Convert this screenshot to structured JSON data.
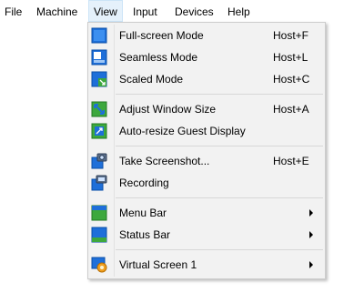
{
  "menubar": {
    "items": [
      {
        "label": "File"
      },
      {
        "label": "Machine"
      },
      {
        "label": "View"
      },
      {
        "label": "Input"
      },
      {
        "label": "Devices"
      },
      {
        "label": "Help"
      }
    ]
  },
  "view_menu": {
    "items": [
      {
        "label": "Full-screen Mode",
        "shortcut": "Host+F",
        "icon": "fullscreen-icon"
      },
      {
        "label": "Seamless Mode",
        "shortcut": "Host+L",
        "icon": "seamless-icon"
      },
      {
        "label": "Scaled Mode",
        "shortcut": "Host+C",
        "icon": "scaled-icon"
      },
      {
        "label": "Adjust Window Size",
        "shortcut": "Host+A",
        "icon": "adjust-window-icon"
      },
      {
        "label": "Auto-resize Guest Display",
        "shortcut": "",
        "icon": "auto-resize-icon"
      },
      {
        "label": "Take Screenshot...",
        "shortcut": "Host+E",
        "icon": "camera-icon"
      },
      {
        "label": "Recording",
        "shortcut": "",
        "icon": "recording-icon"
      },
      {
        "label": "Menu Bar",
        "shortcut": "",
        "icon": "menu-bar-icon",
        "submenu": true
      },
      {
        "label": "Status Bar",
        "shortcut": "",
        "icon": "status-bar-icon",
        "submenu": true
      },
      {
        "label": "Virtual Screen 1",
        "shortcut": "",
        "icon": "virtual-screen-icon",
        "submenu": true
      }
    ]
  },
  "colors": {
    "menu_background": "#f2f2f2",
    "active_menu_highlight": "#e5f1fb",
    "icon_blue": "#1e6fd9",
    "icon_green": "#3da83d"
  }
}
